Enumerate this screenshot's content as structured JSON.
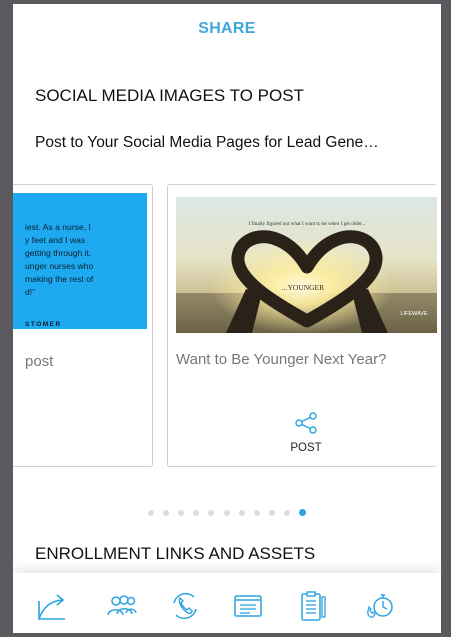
{
  "header": {
    "title": "SHARE"
  },
  "social": {
    "heading": "SOCIAL MEDIA IMAGES TO POST",
    "subtitle": "Post to Your Social Media Pages for Lead Gene…"
  },
  "cards": {
    "left": {
      "quote_lines": [
        "iest. As a nurse, I",
        "y feet and I was",
        "getting through it.",
        "unger nurses who",
        "making the rest of",
        "d!\""
      ],
      "quote_author": "STOMER",
      "caption": "post"
    },
    "main": {
      "image_top_text": "I finally figured out what I want to be when I get older...",
      "image_center_text": "...YOUNGER",
      "image_brand": "LIFEWAVE",
      "caption": "Want to Be Younger Next Year?",
      "post_label": "POST"
    }
  },
  "pagination": {
    "count": 11,
    "active_index": 10
  },
  "enrollment": {
    "heading": "ENROLLMENT LINKS AND ASSETS"
  },
  "colors": {
    "accent": "#3ea8d9",
    "quote_bg": "#1eaaf1"
  },
  "tabbar": {
    "items": [
      {
        "icon": "share-arrow-icon"
      },
      {
        "icon": "people-icon"
      },
      {
        "icon": "phone-cycle-icon"
      },
      {
        "icon": "notes-icon"
      },
      {
        "icon": "clipboard-icon"
      },
      {
        "icon": "timer-icon"
      }
    ]
  }
}
